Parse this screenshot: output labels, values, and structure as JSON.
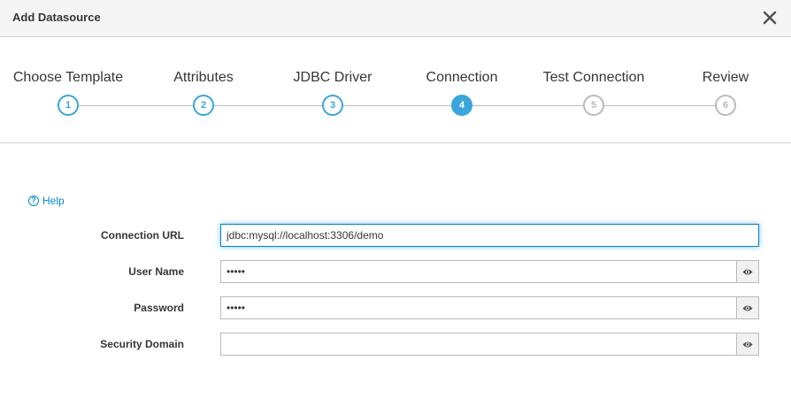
{
  "dialog": {
    "title": "Add Datasource"
  },
  "wizard": {
    "steps": [
      {
        "label": "Choose Template",
        "number": "1",
        "state": "done"
      },
      {
        "label": "Attributes",
        "number": "2",
        "state": "done"
      },
      {
        "label": "JDBC Driver",
        "number": "3",
        "state": "done"
      },
      {
        "label": "Connection",
        "number": "4",
        "state": "active"
      },
      {
        "label": "Test Connection",
        "number": "5",
        "state": "future"
      },
      {
        "label": "Review",
        "number": "6",
        "state": "future"
      }
    ]
  },
  "help": {
    "label": "Help",
    "icon": "question-circle-icon"
  },
  "form": {
    "connection_url": {
      "label": "Connection URL",
      "value": "jdbc:mysql://localhost:3306/demo"
    },
    "user_name": {
      "label": "User Name",
      "value": "•••••"
    },
    "password": {
      "label": "Password",
      "value": "•••••"
    },
    "security_domain": {
      "label": "Security Domain",
      "value": ""
    }
  },
  "colors": {
    "accent": "#39a5dc",
    "link": "#0088ce",
    "inactive": "#bbbbbb"
  }
}
